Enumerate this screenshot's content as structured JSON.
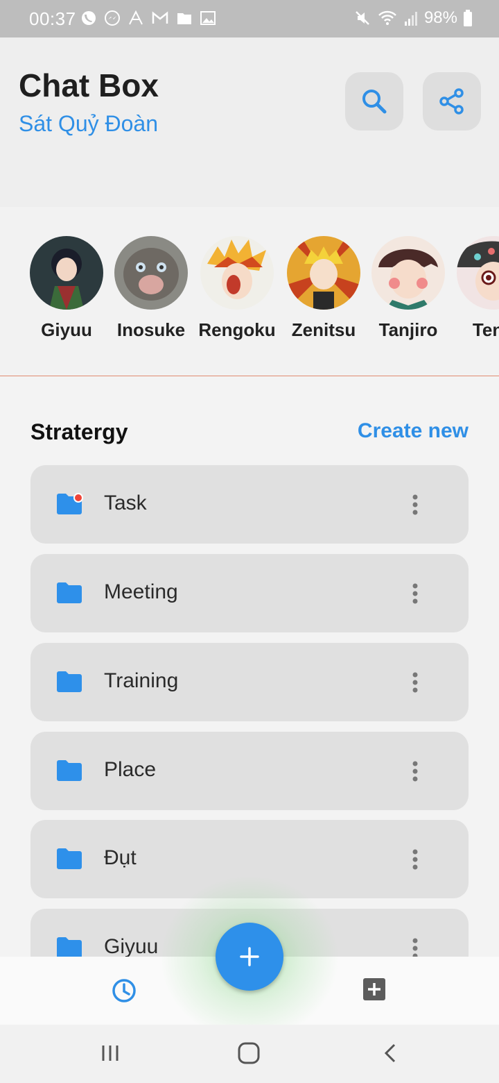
{
  "status_bar": {
    "time": "00:37",
    "battery": "98%",
    "notification_icons": [
      "viber-icon",
      "messenger-icon",
      "app-icon",
      "gmail-icon",
      "folder-icon",
      "image-icon"
    ],
    "system_icons": [
      "mute-icon",
      "wifi-icon",
      "signal-icon",
      "battery-icon"
    ]
  },
  "header": {
    "title": "Chat Box",
    "subtitle": "Sát Quỷ Đoàn",
    "actions": [
      "search-icon",
      "share-icon"
    ]
  },
  "stories": [
    {
      "name": "Giyuu"
    },
    {
      "name": "Inosuke"
    },
    {
      "name": "Rengoku"
    },
    {
      "name": "Zenitsu"
    },
    {
      "name": "Tanjiro"
    },
    {
      "name": "Teng"
    }
  ],
  "section": {
    "title": "Stratergy",
    "action": "Create new"
  },
  "folders": [
    {
      "label": "Task",
      "unread": true
    },
    {
      "label": "Meeting",
      "unread": false
    },
    {
      "label": "Training",
      "unread": false
    },
    {
      "label": "Place",
      "unread": false
    },
    {
      "label": "Đụt",
      "unread": false
    },
    {
      "label": "Giyuu",
      "unread": false
    }
  ],
  "bottom_bar": {
    "left_icon": "history-icon",
    "center_icon": "plus-icon",
    "right_icon": "add-box-icon"
  },
  "colors": {
    "accent": "#2f8fe6",
    "folder": "#2e90ea",
    "card": "#e0e0e0",
    "unread_dot": "#f04438"
  }
}
